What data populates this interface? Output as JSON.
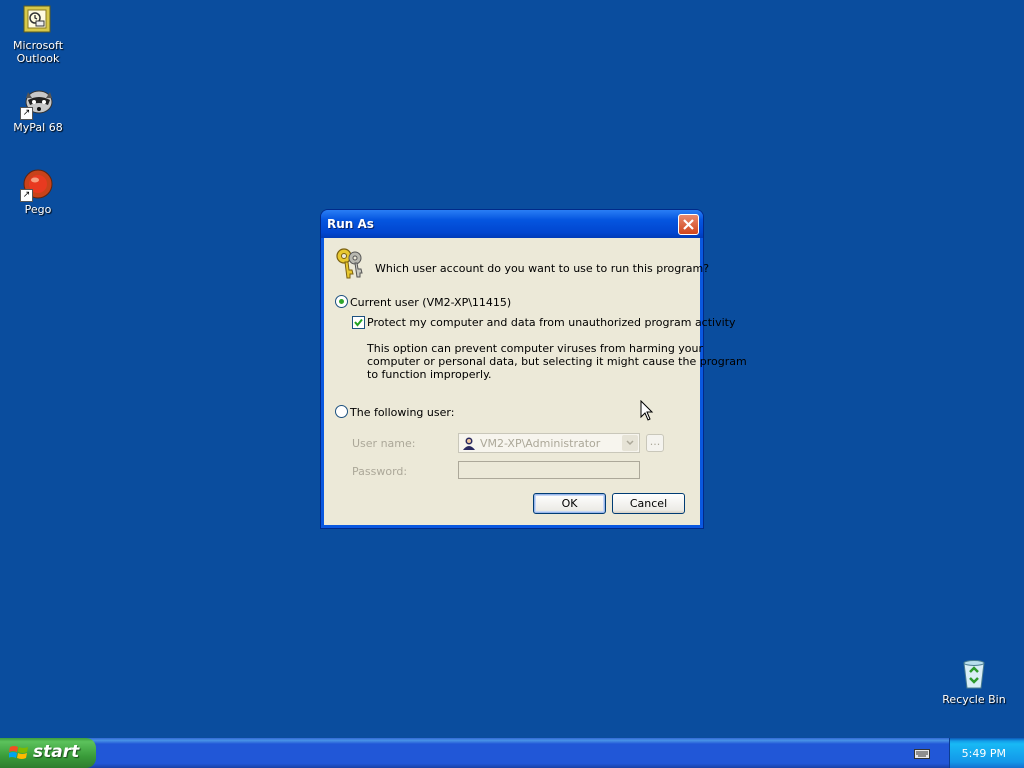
{
  "desktop": {
    "icons": [
      {
        "label_line1": "Microsoft",
        "label_line2": "Outlook",
        "icon": "outlook-icon"
      },
      {
        "label": "MyPal 68",
        "icon": "mypal-icon"
      },
      {
        "label": "Pego",
        "icon": "pego-icon"
      },
      {
        "label": "Recycle Bin",
        "icon": "recycle-bin-icon"
      }
    ]
  },
  "dialog": {
    "title": "Run As",
    "question": "Which user account do you want to use to run this program?",
    "current_user_label": "Current user (VM2-XP\\11415)",
    "current_user_selected": true,
    "protect_label": "Protect my computer and data from unauthorized program activity",
    "protect_checked": true,
    "info_line1": "This option can prevent computer viruses from harming your",
    "info_line2": "computer or personal data, but selecting it might cause the program",
    "info_line3": "to function improperly.",
    "following_user_label": "The following user:",
    "username_label": "User name:",
    "username_value": "VM2-XP\\Administrator",
    "browse_label": "...",
    "password_label": "Password:",
    "password_value": "",
    "ok_label": "OK",
    "cancel_label": "Cancel"
  },
  "taskbar": {
    "start_label": "start",
    "clock": "5:49 PM"
  },
  "colors": {
    "desktop": "#0a4d9e",
    "titlebar": "#0556e0",
    "dialog_face": "#ece9d8",
    "start_button": "#3a9c3a"
  }
}
